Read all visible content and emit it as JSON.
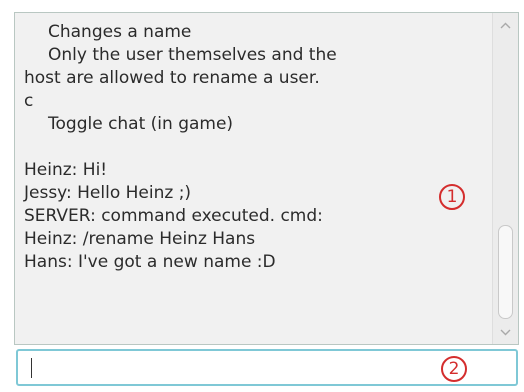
{
  "chat": {
    "lines": [
      {
        "text": "Changes a name",
        "indent": true
      },
      {
        "text": "Only the user themselves and the",
        "indent": true
      },
      {
        "text": "host are allowed to rename a user.",
        "indent": false
      },
      {
        "text": "c",
        "indent": false
      },
      {
        "text": "Toggle chat (in game)",
        "indent": true
      },
      {
        "text": "",
        "indent": false
      },
      {
        "text": "Heinz: Hi!",
        "indent": false
      },
      {
        "text": "Jessy: Hello Heinz ;)",
        "indent": false
      },
      {
        "text": "SERVER: command executed. cmd:",
        "indent": false
      },
      {
        "text": "Heinz: /rename Heinz Hans",
        "indent": false
      },
      {
        "text": "Hans: I've got a new name :D",
        "indent": false
      }
    ]
  },
  "scrollbar": {
    "up_icon": "chevron-up-icon",
    "down_icon": "chevron-down-icon",
    "up_glyph": "^",
    "down_glyph": "v"
  },
  "input": {
    "value": "",
    "placeholder": ""
  },
  "annotations": {
    "marker_1": "1",
    "marker_2": "2",
    "color": "#d42d2d"
  },
  "colors": {
    "panel_bg": "#f1f1f1",
    "input_border": "#7fc8d6",
    "text": "#2b2b2b"
  }
}
